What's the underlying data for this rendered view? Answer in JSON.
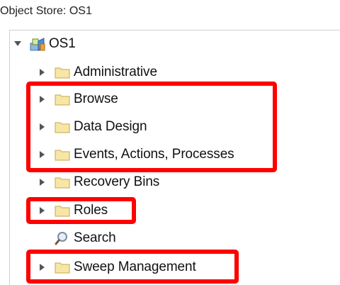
{
  "header": {
    "title": "Object Store: OS1"
  },
  "tree": {
    "root": {
      "label": "OS1",
      "icon": "object-store-icon",
      "expanded": true
    },
    "items": [
      {
        "label": "Administrative",
        "icon": "folder-icon",
        "expandable": true
      },
      {
        "label": "Browse",
        "icon": "folder-icon",
        "expandable": true
      },
      {
        "label": "Data Design",
        "icon": "folder-icon",
        "expandable": true
      },
      {
        "label": "Events, Actions, Processes",
        "icon": "folder-icon",
        "expandable": true
      },
      {
        "label": "Recovery Bins",
        "icon": "folder-icon",
        "expandable": true
      },
      {
        "label": "Roles",
        "icon": "folder-icon",
        "expandable": true
      },
      {
        "label": "Search",
        "icon": "search-icon",
        "expandable": false
      },
      {
        "label": "Sweep Management",
        "icon": "folder-icon",
        "expandable": true
      }
    ]
  },
  "colors": {
    "highlight": "#ff0000",
    "folder_fill": "#f7e6a6",
    "folder_stroke": "#c9a64a",
    "twisty": "#555555"
  }
}
